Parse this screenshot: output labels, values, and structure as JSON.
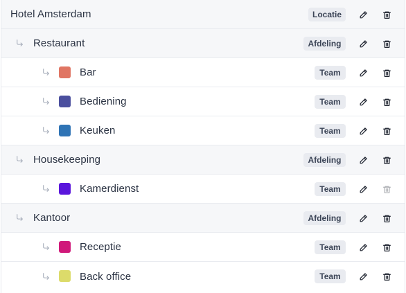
{
  "rows": [
    {
      "name": "Hotel Amsterdam",
      "badge": "Locatie",
      "level": 0,
      "color": null,
      "delete_enabled": true
    },
    {
      "name": "Restaurant",
      "badge": "Afdeling",
      "level": 1,
      "color": null,
      "delete_enabled": true
    },
    {
      "name": "Bar",
      "badge": "Team",
      "level": 2,
      "color": "#e07563",
      "delete_enabled": true
    },
    {
      "name": "Bediening",
      "badge": "Team",
      "level": 2,
      "color": "#4b4f9e",
      "delete_enabled": true
    },
    {
      "name": "Keuken",
      "badge": "Team",
      "level": 2,
      "color": "#2f74b5",
      "delete_enabled": true
    },
    {
      "name": "Housekeeping",
      "badge": "Afdeling",
      "level": 1,
      "color": null,
      "delete_enabled": true
    },
    {
      "name": "Kamerdienst",
      "badge": "Team",
      "level": 2,
      "color": "#5a16dc",
      "delete_enabled": false
    },
    {
      "name": "Kantoor",
      "badge": "Afdeling",
      "level": 1,
      "color": null,
      "delete_enabled": true
    },
    {
      "name": "Receptie",
      "badge": "Team",
      "level": 2,
      "color": "#d0197a",
      "delete_enabled": true
    },
    {
      "name": "Back office",
      "badge": "Team",
      "level": 2,
      "color": "#dcdb6a",
      "delete_enabled": true
    }
  ],
  "icons": {
    "child_arrow": "corner-down-right-icon",
    "edit": "pencil-icon",
    "delete": "trash-icon"
  }
}
